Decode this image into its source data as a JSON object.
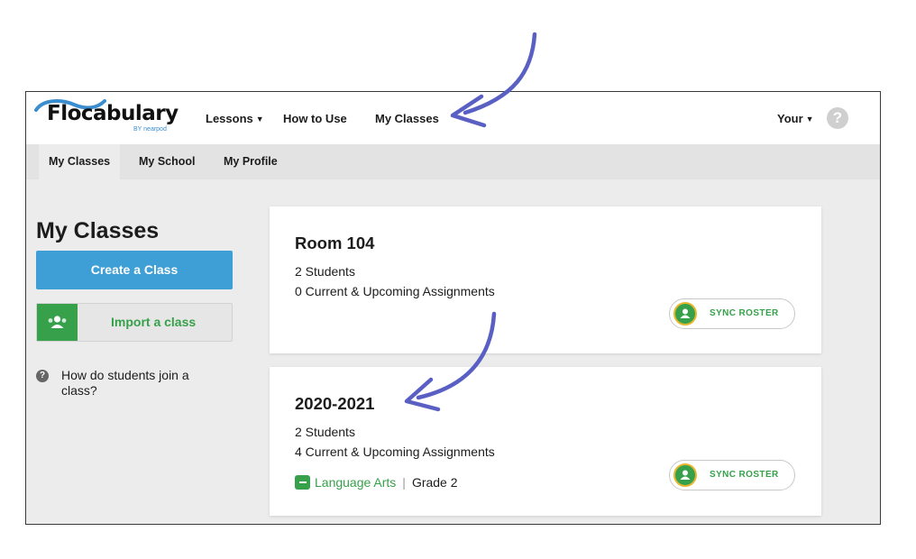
{
  "header": {
    "logo_text": "Flocabulary",
    "logo_sub": "BY nearpod",
    "nav": [
      {
        "label": "Lessons"
      },
      {
        "label": "How to Use"
      },
      {
        "label": "My Classes"
      }
    ],
    "account_label": "Your",
    "help_glyph": "?"
  },
  "subnav": {
    "items": [
      {
        "label": "My Classes"
      },
      {
        "label": "My School"
      },
      {
        "label": "My Profile"
      }
    ]
  },
  "sidebar": {
    "title": "My Classes",
    "create_button": "Create a Class",
    "import_button": "Import a class",
    "help_link": "How do students join a class?"
  },
  "classes": [
    {
      "name": "Room 104",
      "students": "2 Students",
      "assignments": "0 Current & Upcoming Assignments",
      "sync_label": "SYNC ROSTER"
    },
    {
      "name": "2020-2021",
      "students": "2 Students",
      "assignments": "4 Current & Upcoming Assignments",
      "subject": "Language Arts",
      "grade": "Grade 2",
      "sync_label": "SYNC ROSTER"
    }
  ],
  "colors": {
    "accent_blue": "#3e9fd6",
    "green": "#36a14a",
    "annotation_arrow": "#5a5fc4"
  },
  "icons": [
    "dropdown-caret-icon",
    "help-icon",
    "google-classroom-icon",
    "subject-book-icon",
    "annotation-arrow-icon"
  ]
}
